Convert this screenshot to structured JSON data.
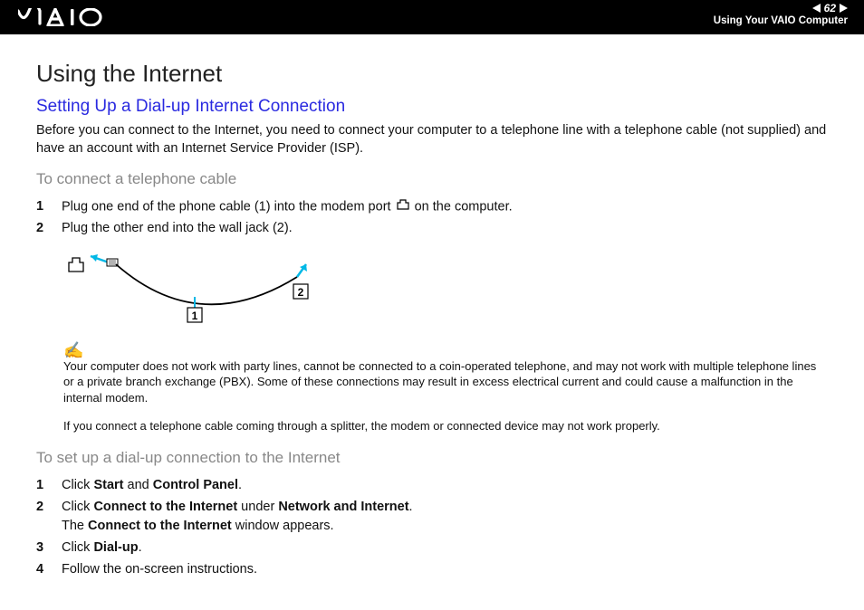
{
  "header": {
    "page_number": "62",
    "subtitle": "Using Your VAIO Computer"
  },
  "title": "Using the Internet",
  "section_title": "Setting Up a Dial-up Internet Connection",
  "intro": "Before you can connect to the Internet, you need to connect your computer to a telephone line with a telephone cable (not supplied) and have an account with an Internet Service Provider (ISP).",
  "sub1_title": "To connect a telephone cable",
  "steps1": {
    "s1_pre": "Plug one end of the phone cable (1) into the modem port ",
    "s1_post": " on the computer.",
    "s2": "Plug the other end into the wall jack (2)."
  },
  "figure": {
    "label1": "1",
    "label2": "2"
  },
  "note1": "Your computer does not work with party lines, cannot be connected to a coin-operated telephone, and may not work with multiple telephone lines or a private branch exchange (PBX). Some of these connections may result in excess electrical current and could cause a malfunction in the internal modem.",
  "note2": "If you connect a telephone cable coming through a splitter, the modem or connected device may not work properly.",
  "sub2_title": "To set up a dial-up connection to the Internet",
  "steps2": {
    "s1_a": "Click ",
    "s1_b": "Start",
    "s1_c": " and ",
    "s1_d": "Control Panel",
    "s1_e": ".",
    "s2_a": "Click ",
    "s2_b": "Connect to the Internet",
    "s2_c": " under ",
    "s2_d": "Network and Internet",
    "s2_e": ".",
    "s2_f": "The ",
    "s2_g": "Connect to the Internet",
    "s2_h": " window appears.",
    "s3_a": "Click ",
    "s3_b": "Dial-up",
    "s3_c": ".",
    "s4": "Follow the on-screen instructions."
  }
}
